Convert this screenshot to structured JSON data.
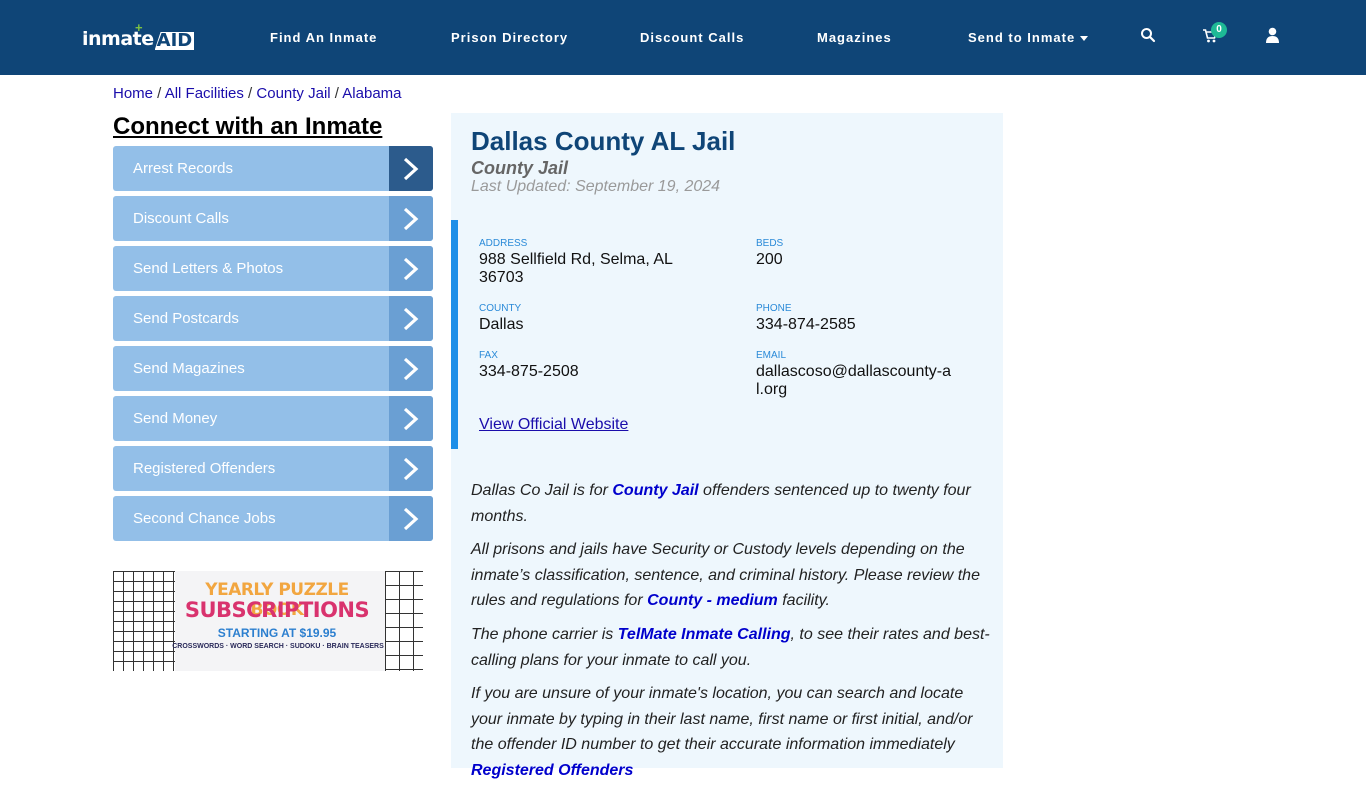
{
  "header": {
    "logo": {
      "part1": "inmate",
      "part2": "AID",
      "plus": "+"
    },
    "nav": [
      {
        "label": "Find An Inmate"
      },
      {
        "label": "Prison Directory"
      },
      {
        "label": "Discount Calls"
      },
      {
        "label": "Magazines"
      },
      {
        "label": "Send to Inmate"
      }
    ],
    "icons": [
      "search-icon",
      "cart-icon",
      "user-icon"
    ],
    "cart_count": "0"
  },
  "breadcrumb": [
    {
      "label": "Home"
    },
    {
      "label": "All Facilities"
    },
    {
      "label": "County Jail"
    },
    {
      "label": "Alabama"
    }
  ],
  "breadcrumb_sep": " / ",
  "sidebar": {
    "title": "Connect with an Inmate",
    "items": [
      {
        "label": "Arrest Records"
      },
      {
        "label": "Discount Calls"
      },
      {
        "label": "Send Letters & Photos"
      },
      {
        "label": "Send Postcards"
      },
      {
        "label": "Send Magazines"
      },
      {
        "label": "Send Money"
      },
      {
        "label": "Registered Offenders"
      },
      {
        "label": "Second Chance Jobs"
      }
    ],
    "ad": {
      "line1": "YEARLY PUZZLE BOOK",
      "line2": "SUBSCRIPTIONS",
      "line3": "STARTING AT $19.95",
      "line4": "CROSSWORDS · WORD SEARCH · SUDOKU · BRAIN TEASERS"
    }
  },
  "facility": {
    "name": "Dallas County AL Jail",
    "type": "County Jail",
    "updated": "Last Updated: September 19, 2024",
    "fields": {
      "address": {
        "label": "Address",
        "value": "988 Sellfield Rd, Selma, AL 36703"
      },
      "beds": {
        "label": "Beds",
        "value": "200"
      },
      "county": {
        "label": "County",
        "value": "Dallas"
      },
      "phone": {
        "label": "Phone",
        "value": "334-874-2585"
      },
      "fax": {
        "label": "Fax",
        "value": "334-875-2508"
      },
      "email": {
        "label": "Email",
        "value": "dallascoso@dallascounty-al.org"
      }
    },
    "website_label": "View Official Website"
  },
  "description": {
    "p1": {
      "pre": "Dallas Co Jail is for ",
      "link": "County Jail",
      "post": " offenders sentenced up to twenty four months."
    },
    "p2": {
      "pre": "All prisons and jails have Security or Custody levels depending on the inmate’s classification, sentence, and criminal history. Please review the rules and regulations for ",
      "link": "County - medium",
      "post": " facility."
    },
    "p3": {
      "pre": "The phone carrier is ",
      "link": "TelMate Inmate Calling",
      "post": ", to see their rates and best-calling plans for your inmate to call you."
    },
    "p4": {
      "pre": "If you are unsure of your inmate's location, you can search and locate your inmate by typing in their last name, first name or first initial, and/or the offender ID number to get their accurate information immediately ",
      "link": "Registered Offenders"
    }
  },
  "colors": {
    "nav_bg": "#0f4577",
    "accent": "#1e8fe8",
    "menu_bg": "#93bfe8",
    "badge": "#1eb995"
  }
}
